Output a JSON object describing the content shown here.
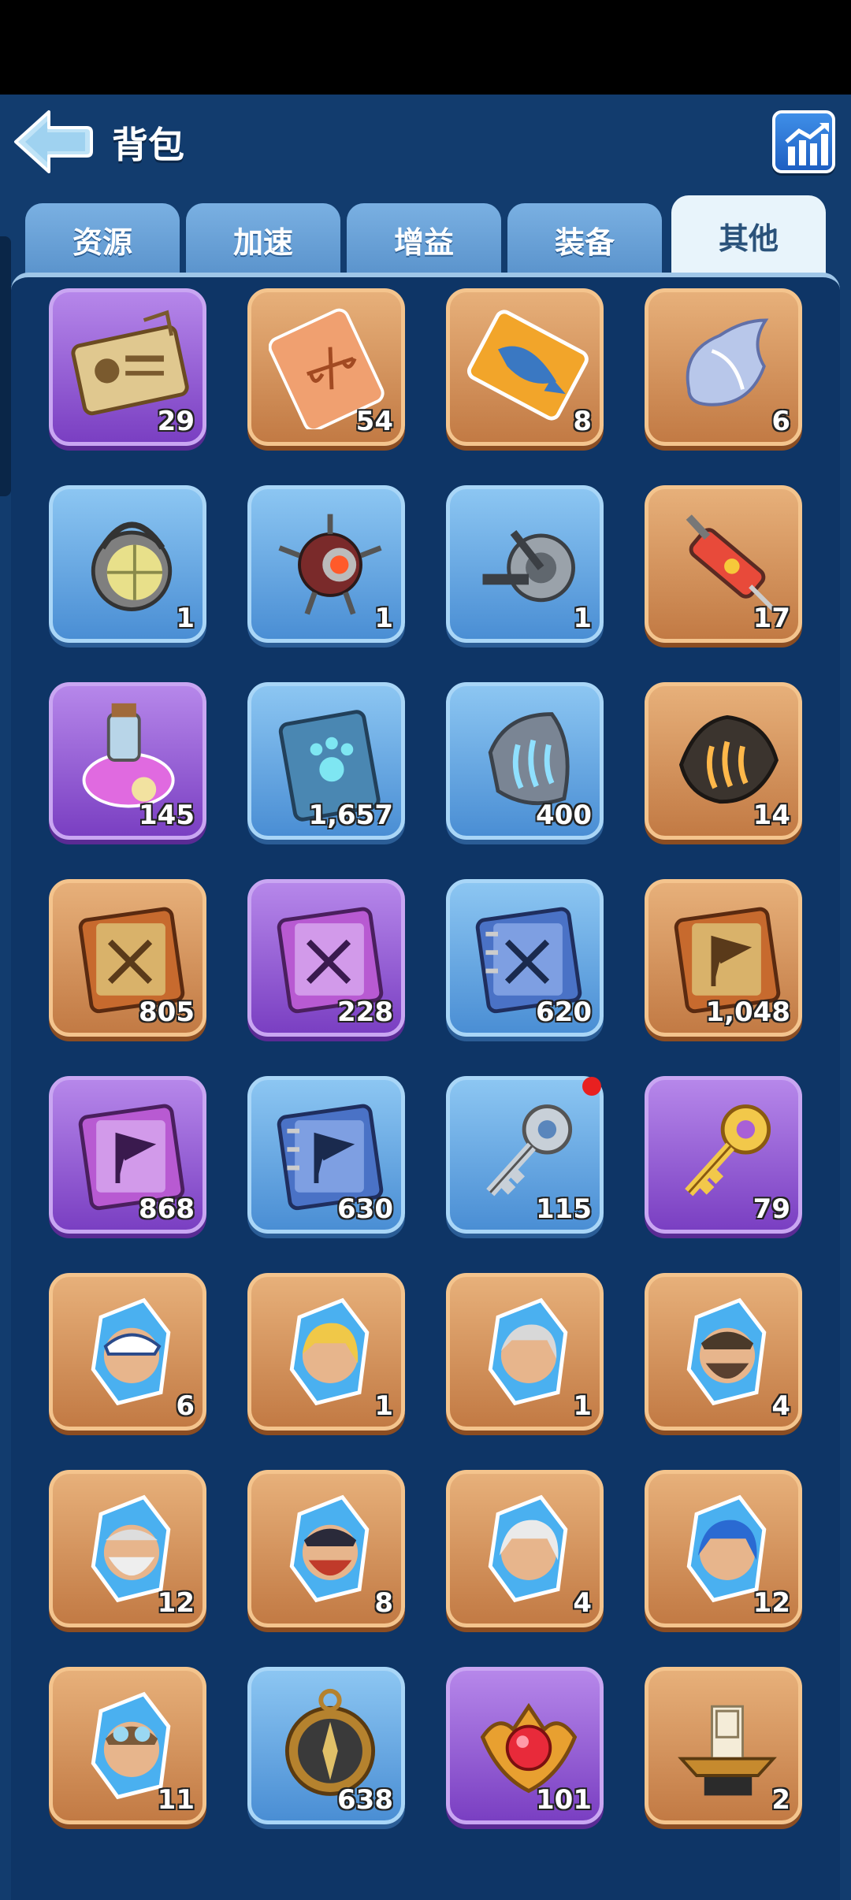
{
  "header": {
    "title": "背包"
  },
  "tabs": [
    {
      "label": "资源",
      "active": false
    },
    {
      "label": "加速",
      "active": false
    },
    {
      "label": "增益",
      "active": false
    },
    {
      "label": "装备",
      "active": false
    },
    {
      "label": "其他",
      "active": true
    }
  ],
  "colors": {
    "background": "#123c6e",
    "purple": "#9b63dc",
    "orange": "#d8955f",
    "blue": "#6aaae6"
  },
  "items": [
    {
      "icon": "id-card-icon",
      "rarity": "purple",
      "count": "29"
    },
    {
      "icon": "ticket-scales-icon",
      "rarity": "orange",
      "count": "54"
    },
    {
      "icon": "fish-ticket-icon",
      "rarity": "orange",
      "count": "8"
    },
    {
      "icon": "shell-icon",
      "rarity": "orange",
      "count": "6"
    },
    {
      "icon": "lamp-icon",
      "rarity": "blue",
      "count": "1"
    },
    {
      "icon": "drone-icon",
      "rarity": "blue",
      "count": "1"
    },
    {
      "icon": "fishing-reel-icon",
      "rarity": "blue",
      "count": "1"
    },
    {
      "icon": "syringe-icon",
      "rarity": "orange",
      "count": "17"
    },
    {
      "icon": "potion-icon",
      "rarity": "purple",
      "count": "145"
    },
    {
      "icon": "paw-book-icon",
      "rarity": "blue",
      "count": "1,657"
    },
    {
      "icon": "blue-claw-stone-icon",
      "rarity": "blue",
      "count": "400"
    },
    {
      "icon": "orange-claw-stone-icon",
      "rarity": "orange",
      "count": "14"
    },
    {
      "icon": "swords-book-orange-icon",
      "rarity": "orange",
      "count": "805"
    },
    {
      "icon": "swords-book-purple-icon",
      "rarity": "purple",
      "count": "228"
    },
    {
      "icon": "swords-notebook-blue-icon",
      "rarity": "blue",
      "count": "620"
    },
    {
      "icon": "flag-book-orange-icon",
      "rarity": "orange",
      "count": "1,048"
    },
    {
      "icon": "flag-book-purple-icon",
      "rarity": "purple",
      "count": "868"
    },
    {
      "icon": "flag-notebook-blue-icon",
      "rarity": "blue",
      "count": "630"
    },
    {
      "icon": "silver-key-icon",
      "rarity": "blue",
      "count": "115",
      "badge": true
    },
    {
      "icon": "gold-key-icon",
      "rarity": "purple",
      "count": "79"
    },
    {
      "icon": "hero-crystal-cap-icon",
      "rarity": "orange",
      "count": "6"
    },
    {
      "icon": "hero-crystal-blonde-icon",
      "rarity": "orange",
      "count": "1"
    },
    {
      "icon": "hero-crystal-grey-hair-icon",
      "rarity": "orange",
      "count": "1"
    },
    {
      "icon": "hero-crystal-bearded-icon",
      "rarity": "orange",
      "count": "4"
    },
    {
      "icon": "hero-crystal-old-man-icon",
      "rarity": "orange",
      "count": "12"
    },
    {
      "icon": "hero-crystal-red-beard-icon",
      "rarity": "orange",
      "count": "8"
    },
    {
      "icon": "hero-crystal-white-hair-icon",
      "rarity": "orange",
      "count": "4"
    },
    {
      "icon": "hero-crystal-blue-hair-icon",
      "rarity": "orange",
      "count": "12"
    },
    {
      "icon": "hero-crystal-goggles-icon",
      "rarity": "orange",
      "count": "11"
    },
    {
      "icon": "compass-icon",
      "rarity": "blue",
      "count": "638"
    },
    {
      "icon": "ruby-amulet-icon",
      "rarity": "purple",
      "count": "101"
    },
    {
      "icon": "ship-trophy-icon",
      "rarity": "orange",
      "count": "2"
    }
  ]
}
